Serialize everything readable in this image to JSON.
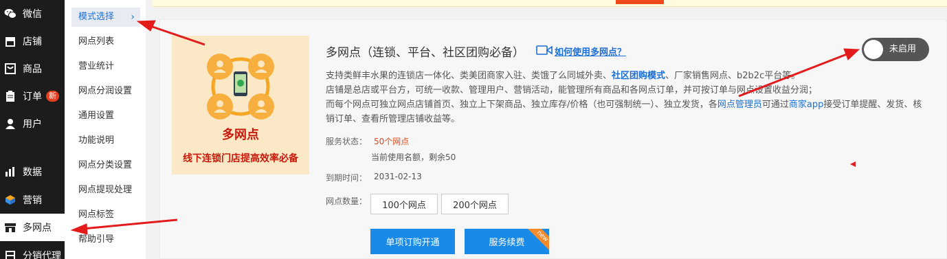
{
  "sidebar": {
    "items": [
      {
        "label": "微信",
        "icon": "wechat-icon"
      },
      {
        "label": "店铺",
        "icon": "store-icon"
      },
      {
        "label": "商品",
        "icon": "goods-icon"
      },
      {
        "label": "订单",
        "icon": "order-icon",
        "badge": "新"
      },
      {
        "label": "用户",
        "icon": "user-icon"
      },
      {
        "label": "数据",
        "icon": "chart-icon"
      },
      {
        "label": "营销",
        "icon": "marketing-icon"
      },
      {
        "label": "多网点",
        "icon": "multi-store-icon"
      },
      {
        "label": "分销代理",
        "icon": "distribution-icon"
      }
    ]
  },
  "submenu": {
    "items": [
      "模式选择",
      "网点列表",
      "营业统计",
      "网点分润设置",
      "通用设置",
      "功能说明",
      "网点分类设置",
      "网点提现处理",
      "网点标签",
      "帮助引导"
    ],
    "chevron": "›"
  },
  "hero": {
    "title": "多网点",
    "subtitle": "线下连锁门店提高效率必备"
  },
  "main": {
    "title": "多网点（连锁、平台、社区团购必备）",
    "help_link": "如何使用多网点？",
    "desc1_a": "支持类鲜丰水果的连锁店一体化、类美团商家入驻、类饿了么同城外卖、",
    "desc1_hl": "社区团购模式",
    "desc1_b": "、厂家销售网点、b2b2c平台等。",
    "desc2": "店铺是总店或平台方，可统一收款、管理用户、营销活动，能管理所有商品和各网点订单，并可按订单与网点设置收益分润；",
    "desc3_a": "而每个网点可独立网点店铺首页、独立上下架商品、独立库存/价格（也可强制统一）、独立发货，各",
    "desc3_hl1": "网点管理员",
    "desc3_b": "可通过",
    "desc3_hl2": "商家app",
    "desc3_c": "接受订单提醒、发货、核",
    "desc4": "销订单、查看所管理店铺收益等。",
    "status_label": "服务状态：",
    "status_value": "50个网点",
    "quota_text": "当前使用名额，剩余50",
    "expire_label": "到期时间：",
    "expire_value": "2031-02-13",
    "count_label": "网点数量：",
    "options": [
      "100个网点",
      "200个网点"
    ],
    "buy_button": "单项订购开通",
    "renew_button": "服务续费",
    "new_ribbon": "new",
    "toggle_label": "未启用"
  },
  "colors": {
    "accent": "#1a8ae8",
    "link": "#1a6fd6",
    "warn": "#e34a1b",
    "sidebar": "#1c1c1c"
  }
}
